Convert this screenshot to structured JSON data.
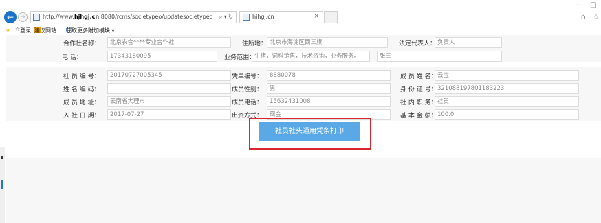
{
  "browser": {
    "url_prefix": "http://www.",
    "url_domain": "hjhgj.cn",
    "url_path": ":8080/rcms/societypeo/updatesocietypeo",
    "address_tools": "⌕ ▾ ↻",
    "tab_title": "hjhgj.cn",
    "tab_close": "×",
    "window_min": "—",
    "window_max": "□"
  },
  "favorites": {
    "login": "登录",
    "suggested": "建议网站",
    "more_addons": "获取更多附加模块 ▾"
  },
  "form": {
    "coop_name_label": "合作社名称：",
    "coop_name_value": "北京农合****专业合作社",
    "address_label": "住所地：",
    "address_value": "北京市海淀区西三旗",
    "legal_rep_label": "法定代表人：",
    "legal_rep_value": "负责人",
    "phone_label": "电    话：",
    "phone_value": "17343180095",
    "business_label": "业务范围：",
    "business_value": "生猪，饲料销售，技术咨询，业务服务。",
    "extra_value": "张三",
    "member_no_label": "社 员 编 号：",
    "member_no_value": "20170727005345",
    "voucher_no_label": "凭单编号：",
    "voucher_no_value": "8880078",
    "member_name_label": "成 员 姓 名：",
    "member_name_value": "云宝",
    "name_code_label": "姓 名 编 码：",
    "name_code_value": "",
    "gender_label": "成员性别：",
    "gender_value": "男",
    "id_label": "身 份 证 号：",
    "id_value": "321088197801183223",
    "member_addr_label": "成 员 地 址：",
    "member_addr_value": "云南省大理市",
    "member_phone_label": "成员电话：",
    "member_phone_value": "15632431008",
    "role_label": "社 内 职 务：",
    "role_value": "社员",
    "join_date_label": "入 社 日 期：",
    "join_date_value": "2017-07-27",
    "contrib_label": "出资方式：",
    "contrib_value": "现金",
    "base_amount_label": "基 本 金 额：",
    "base_amount_value": "100.0"
  },
  "print_button": "社员社头通用凭条打印"
}
